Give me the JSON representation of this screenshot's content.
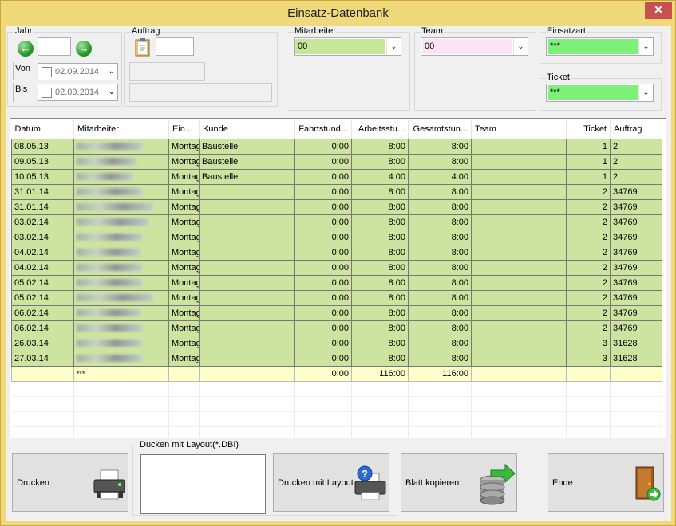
{
  "window": {
    "title": "Einsatz-Datenbank",
    "close_glyph": "✕"
  },
  "filters": {
    "jahr": {
      "label": "Jahr",
      "value": ""
    },
    "von": {
      "label": "Von",
      "date": "02.09.2014"
    },
    "bis": {
      "label": "Bis",
      "date": "02.09.2014"
    },
    "auftrag": {
      "label": "Auftrag",
      "value": ""
    },
    "mitarbeiter": {
      "label": "Mitarbeiter",
      "value": "00",
      "color": "#c6e69a"
    },
    "team": {
      "label": "Team",
      "value": "00",
      "color": "#fce4f4"
    },
    "einsatzart": {
      "label": "Einsatzart",
      "value": "***",
      "color": "#7ef07a"
    },
    "ticket": {
      "label": "Ticket",
      "value": "***",
      "color": "#7ef07a"
    }
  },
  "table": {
    "columns": [
      "Datum",
      "Mitarbeiter",
      "Ein...",
      "Kunde",
      "Fahrtstund...",
      "Arbeitsstu...",
      "Gesamtstun...",
      "Team",
      "Ticket",
      "Auftrag"
    ],
    "rows": [
      [
        "08.05.13",
        "",
        "Montag",
        "Baustelle",
        "0:00",
        "8:00",
        "8:00",
        "",
        "1",
        "2"
      ],
      [
        "09.05.13",
        "",
        "Montag",
        "Baustelle",
        "0:00",
        "8:00",
        "8:00",
        "",
        "1",
        "2"
      ],
      [
        "10.05.13",
        "",
        "Montag",
        "Baustelle",
        "0:00",
        "4:00",
        "4:00",
        "",
        "1",
        "2"
      ],
      [
        "31.01.14",
        "",
        "Montag",
        "",
        "0:00",
        "8:00",
        "8:00",
        "",
        "2",
        "34769"
      ],
      [
        "31.01.14",
        "",
        "Montag",
        "",
        "0:00",
        "8:00",
        "8:00",
        "",
        "2",
        "34769"
      ],
      [
        "03.02.14",
        "",
        "Montag",
        "",
        "0:00",
        "8:00",
        "8:00",
        "",
        "2",
        "34769"
      ],
      [
        "03.02.14",
        "",
        "Montag",
        "",
        "0:00",
        "8:00",
        "8:00",
        "",
        "2",
        "34769"
      ],
      [
        "04.02.14",
        "",
        "Montag",
        "",
        "0:00",
        "8:00",
        "8:00",
        "",
        "2",
        "34769"
      ],
      [
        "04.02.14",
        "",
        "Montag",
        "",
        "0:00",
        "8:00",
        "8:00",
        "",
        "2",
        "34769"
      ],
      [
        "05.02.14",
        "",
        "Montag",
        "",
        "0:00",
        "8:00",
        "8:00",
        "",
        "2",
        "34769"
      ],
      [
        "05.02.14",
        "",
        "Montag",
        "",
        "0:00",
        "8:00",
        "8:00",
        "",
        "2",
        "34769"
      ],
      [
        "06.02.14",
        "",
        "Montag",
        "",
        "0:00",
        "8:00",
        "8:00",
        "",
        "2",
        "34769"
      ],
      [
        "06.02.14",
        "",
        "Montag",
        "",
        "0:00",
        "8:00",
        "8:00",
        "",
        "2",
        "34769"
      ],
      [
        "26.03.14",
        "",
        "Montag",
        "",
        "0:00",
        "8:00",
        "8:00",
        "",
        "3",
        "31628"
      ],
      [
        "27.03.14",
        "",
        "Montag",
        "",
        "0:00",
        "8:00",
        "8:00",
        "",
        "3",
        "31628"
      ]
    ],
    "total": [
      "",
      "***",
      "",
      "",
      "0:00",
      "116:00",
      "116:00",
      "",
      "",
      ""
    ],
    "row_color": "#cde4a0",
    "total_color": "#fefecb"
  },
  "bottom": {
    "drucken_label": "Drucken",
    "layout_group_label": "Ducken mit Layout(*.DBI)",
    "drucken_layout_label": "Drucken mit   Layout",
    "blatt_kopieren_label": "Blatt kopieren",
    "ende_label": "Ende"
  }
}
